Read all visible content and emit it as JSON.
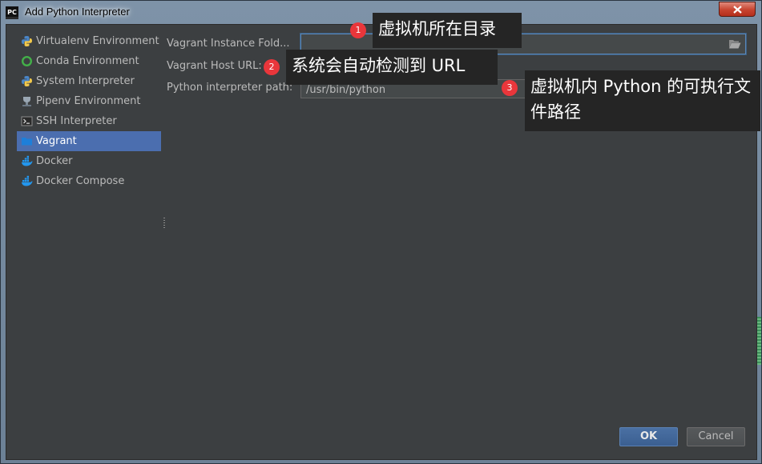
{
  "window": {
    "title": "Add Python Interpreter",
    "app_icon_text": "PC"
  },
  "sidebar": {
    "items": [
      {
        "label": "Virtualenv Environment",
        "icon": "python-icon"
      },
      {
        "label": "Conda Environment",
        "icon": "conda-icon"
      },
      {
        "label": "System Interpreter",
        "icon": "python-icon"
      },
      {
        "label": "Pipenv Environment",
        "icon": "pipenv-icon"
      },
      {
        "label": "SSH Interpreter",
        "icon": "terminal-icon"
      },
      {
        "label": "Vagrant",
        "icon": "folder-icon",
        "selected": true
      },
      {
        "label": "Docker",
        "icon": "docker-icon"
      },
      {
        "label": "Docker Compose",
        "icon": "docker-icon"
      }
    ]
  },
  "form": {
    "instance_folder_label": "Vagrant Instance Fold...",
    "instance_folder_value": "",
    "host_url_label": "Vagrant Host URL:",
    "interpreter_path_label": "Python interpreter path:",
    "interpreter_path_value": "/usr/bin/python"
  },
  "annotations": [
    {
      "number": "1",
      "text": "虚拟机所在目录"
    },
    {
      "number": "2",
      "text": "系统会自动检测到 URL"
    },
    {
      "number": "3",
      "text": "虚拟机内 Python 的可执行文件路径"
    }
  ],
  "buttons": {
    "ok": "OK",
    "cancel": "Cancel"
  },
  "colors": {
    "selection": "#4b6eaf",
    "dialog_bg": "#3c3f41",
    "annotation_badge": "#e9363b"
  }
}
